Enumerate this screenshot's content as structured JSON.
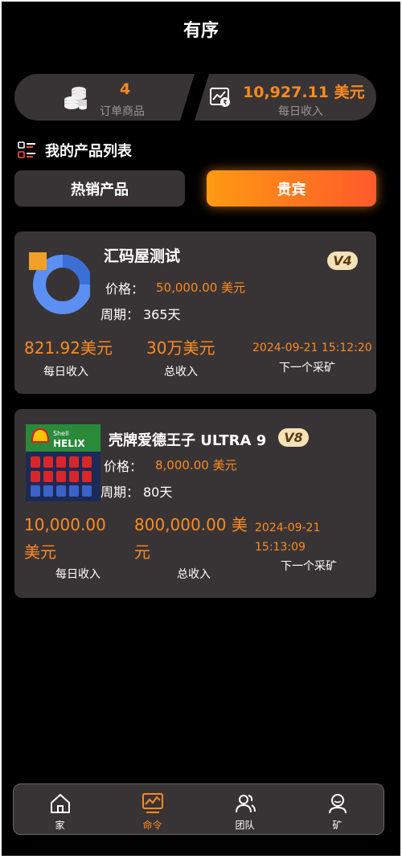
{
  "header": {
    "title": "有序"
  },
  "stats": {
    "orders": {
      "value": "4",
      "label": "订单商品",
      "icon": "coins-icon"
    },
    "income": {
      "value": "10,927.11 美元",
      "label": "每日收入",
      "icon": "chart-icon"
    }
  },
  "section": {
    "title": "我的产品列表",
    "icon": "list-icon"
  },
  "tabs": [
    {
      "label": "热销产品",
      "active": false
    },
    {
      "label": "贵宾",
      "active": true
    }
  ],
  "products": [
    {
      "name": "汇码屋测试",
      "badge": "V4",
      "price_label": "价格：",
      "price_value": "50,000.00 美元",
      "period_label": "周期：",
      "period_value": "365天",
      "daily_value": "821.92美元",
      "daily_label": "每日收入",
      "total_value": "30万美元",
      "total_label": "总收入",
      "next_value": "2024-09-21 15:12:20",
      "next_label": "下一个采矿"
    },
    {
      "name": "壳牌爱德王子 ULTRA 9",
      "badge": "V8",
      "image_text": "Shell HELIX",
      "price_label": "价格：",
      "price_value": "8,000.00 美元",
      "period_label": "周期：",
      "period_value": "80天",
      "daily_value": "10,000.00 美元",
      "daily_label": "每日收入",
      "total_value": "800,000.00 美元",
      "total_label": "总收入",
      "next_value": "2024-09-21 15:13:09",
      "next_label": "下一个采矿"
    }
  ],
  "nav": [
    {
      "label": "家",
      "icon": "home-icon",
      "active": false
    },
    {
      "label": "命令",
      "icon": "orders-chart-icon",
      "active": true
    },
    {
      "label": "团队",
      "icon": "team-icon",
      "active": false
    },
    {
      "label": "矿",
      "icon": "profile-icon",
      "active": false
    }
  ],
  "colors": {
    "accent": "#ff8a1e",
    "card": "#383436",
    "background": "#000000"
  }
}
